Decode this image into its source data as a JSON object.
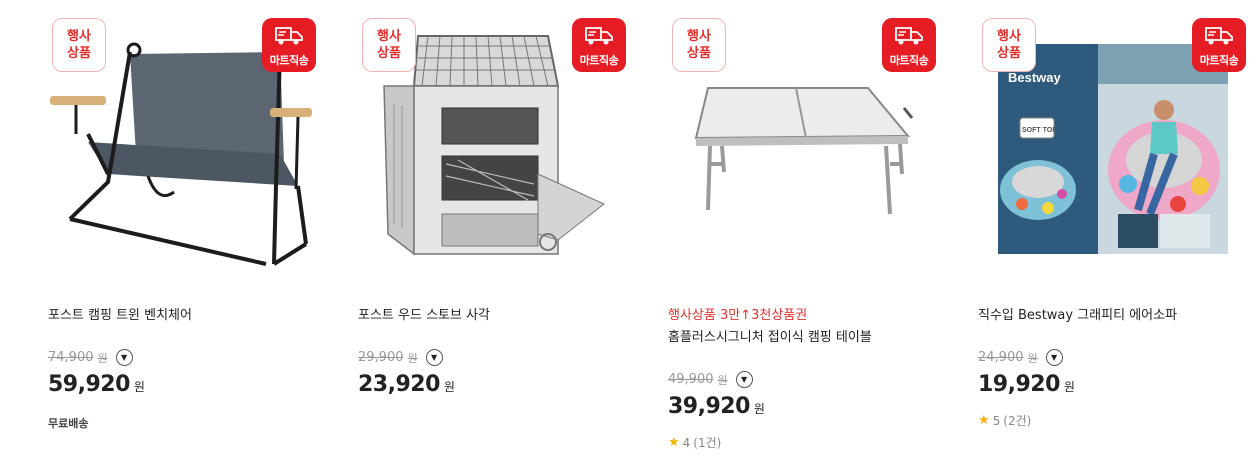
{
  "badges": {
    "event_line1": "행사",
    "event_line2": "상품",
    "mart": "마트직송"
  },
  "products": [
    {
      "title": "포스트 캠핑 트윈 벤치체어",
      "original_price": "74,900",
      "original_unit": "원",
      "price": "59,920",
      "price_unit": "원",
      "shipping": "무료배송",
      "image_icon": "bench-chair-image"
    },
    {
      "title": "포스트 우드 스토브 사각",
      "original_price": "29,900",
      "original_unit": "원",
      "price": "23,920",
      "price_unit": "원",
      "image_icon": "wood-stove-image"
    },
    {
      "promo": "행사상품 3만↑3천상품권",
      "title": "홈플러스시그니처 접이식 캠핑 테이블",
      "original_price": "49,900",
      "original_unit": "원",
      "price": "39,920",
      "price_unit": "원",
      "rating": "4",
      "review_count": "(1건)",
      "image_icon": "folding-table-image"
    },
    {
      "title": "직수입 Bestway 그래피티 에어소파",
      "original_price": "24,900",
      "original_unit": "원",
      "price": "19,920",
      "price_unit": "원",
      "rating": "5",
      "review_count": "(2건)",
      "image_icon": "air-sofa-image",
      "box_brand": "Bestway",
      "box_tag": "SOFT TOP"
    }
  ],
  "colors": {
    "accent_red": "#e51c23",
    "promo_red": "#e0312e",
    "star": "#f5b400"
  }
}
